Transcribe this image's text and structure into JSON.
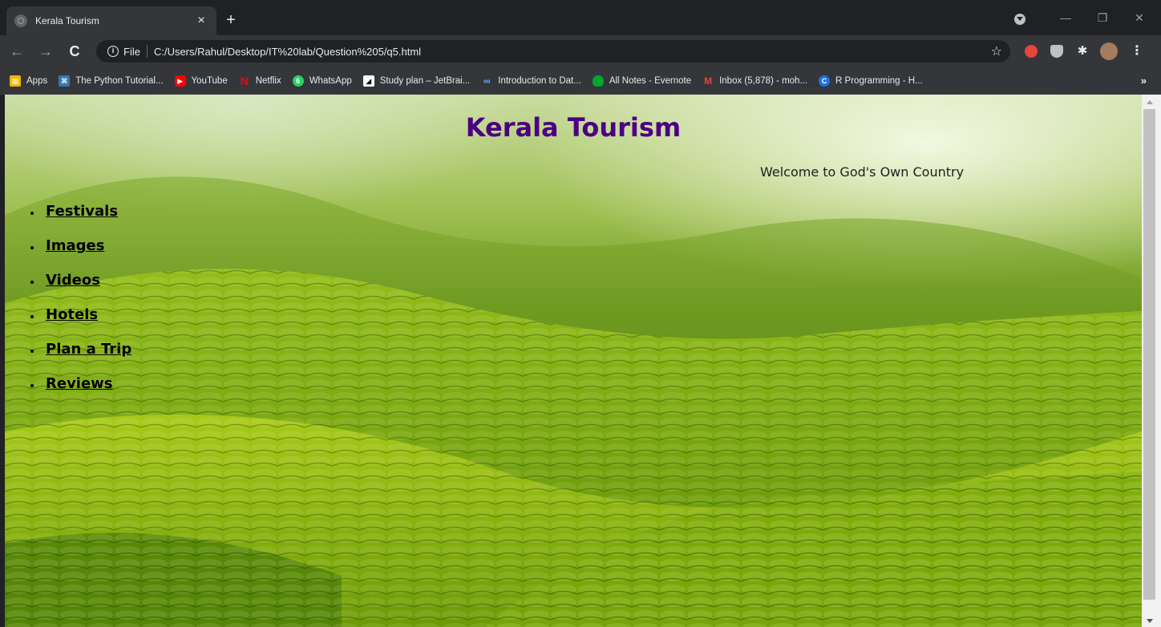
{
  "browser": {
    "tab_title": "Kerala Tourism",
    "tab_close": "×",
    "new_tab": "+",
    "window_controls": {
      "minimize": "—",
      "restore": "❐",
      "close": "✕"
    },
    "nav": {
      "back": "←",
      "forward": "→",
      "reload": "C"
    },
    "address": {
      "scheme_label": "File",
      "url": "C:/Users/Rahul/Desktop/IT%20lab/Question%205/q5.html"
    },
    "bookmarks": [
      {
        "label": "Apps",
        "icon": "apps-grid-icon",
        "color": "#f4b400"
      },
      {
        "label": "The Python Tutorial...",
        "icon": "python-icon",
        "color": "#3776ab"
      },
      {
        "label": "YouTube",
        "icon": "youtube-icon",
        "color": "#ff0000"
      },
      {
        "label": "Netflix",
        "icon": "netflix-icon",
        "color": "#e50914"
      },
      {
        "label": "WhatsApp",
        "icon": "whatsapp-icon",
        "color": "#25d366",
        "badge": "6"
      },
      {
        "label": "Study plan – JetBrai...",
        "icon": "jetbrains-icon",
        "color": "#000000"
      },
      {
        "label": "Introduction to Dat...",
        "icon": "coursera-icon",
        "color": "#2a73cc"
      },
      {
        "label": "All Notes - Evernote",
        "icon": "evernote-icon",
        "color": "#00a82d"
      },
      {
        "label": "Inbox (5,878) - moh...",
        "icon": "gmail-icon",
        "color": "#ea4335"
      },
      {
        "label": "R Programming - H...",
        "icon": "r-programming-icon",
        "color": "#1a73e8",
        "badge": "C"
      }
    ],
    "bookmarks_overflow": "»"
  },
  "page": {
    "title": "Kerala Tourism",
    "subtitle": "Welcome to God's Own Country",
    "title_color": "#4b0082",
    "nav_links": [
      {
        "label": "Festivals"
      },
      {
        "label": "Images"
      },
      {
        "label": "Videos"
      },
      {
        "label": "Hotels"
      },
      {
        "label": "Plan a Trip"
      },
      {
        "label": "Reviews"
      }
    ]
  }
}
